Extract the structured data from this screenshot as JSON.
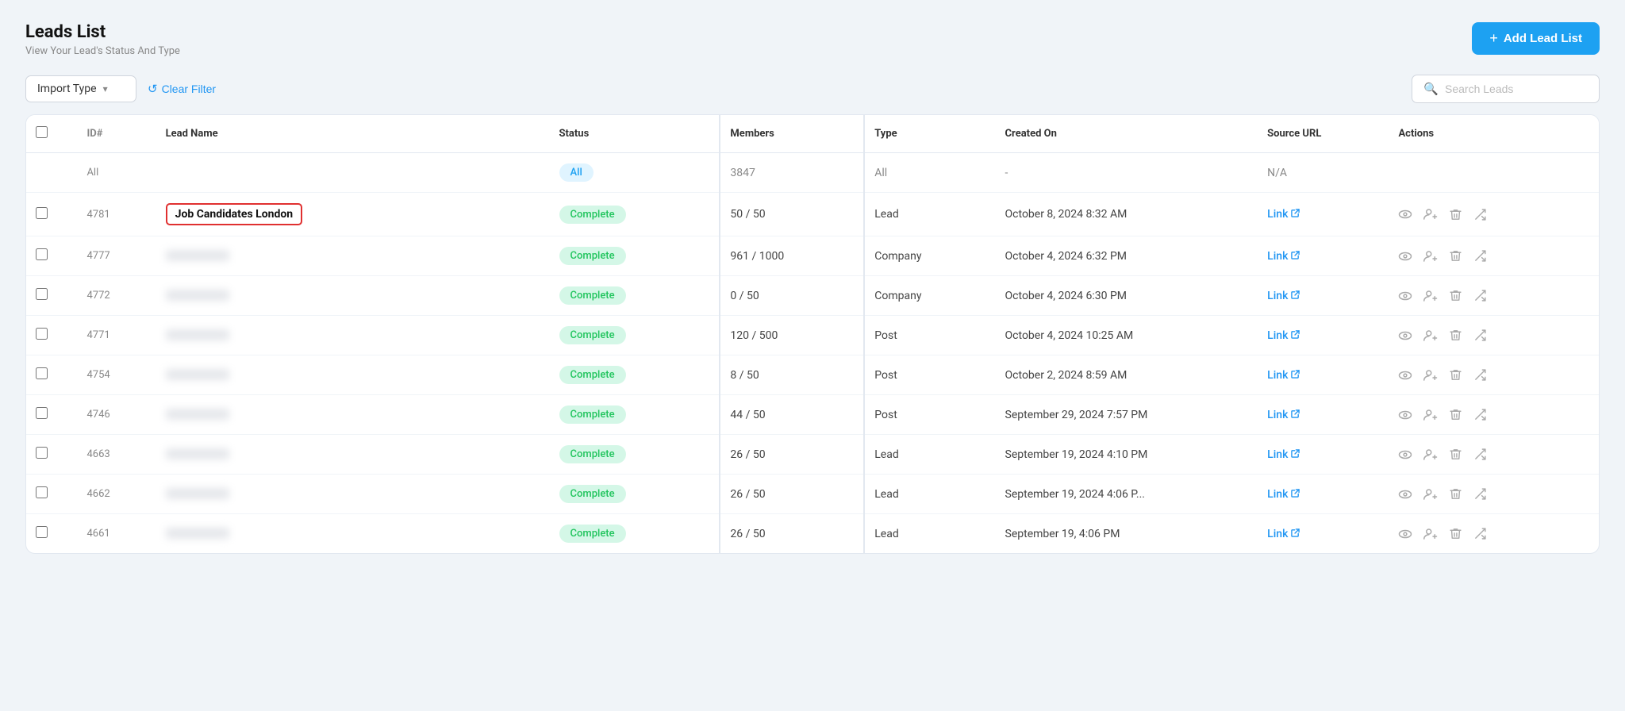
{
  "header": {
    "title": "Leads List",
    "subtitle": "View Your Lead's Status And Type",
    "add_button_label": "Add Lead List"
  },
  "toolbar": {
    "import_type_label": "Import Type",
    "clear_filter_label": "Clear Filter",
    "search_placeholder": "Search Leads"
  },
  "table": {
    "columns": [
      "ID#",
      "Lead Name",
      "Status",
      "Members",
      "Type",
      "Created On",
      "Source URL",
      "Actions"
    ],
    "rows": [
      {
        "id": "All",
        "name": "",
        "blurred": false,
        "is_all": true,
        "status": "All",
        "status_type": "all",
        "members": "3847",
        "type": "All",
        "created": "-",
        "source": "N/A",
        "highlighted": false
      },
      {
        "id": "4781",
        "name": "Job Candidates London",
        "blurred": false,
        "is_all": false,
        "status": "Complete",
        "status_type": "complete",
        "members": "50 / 50",
        "type": "Lead",
        "created": "October 8, 2024 8:32 AM",
        "source": "Link",
        "highlighted": true
      },
      {
        "id": "4777",
        "name": "",
        "blurred": true,
        "is_all": false,
        "status": "Complete",
        "status_type": "complete",
        "members": "961 / 1000",
        "type": "Company",
        "created": "October 4, 2024 6:32 PM",
        "source": "Link",
        "highlighted": false
      },
      {
        "id": "4772",
        "name": "",
        "blurred": true,
        "is_all": false,
        "status": "Complete",
        "status_type": "complete",
        "members": "0 / 50",
        "type": "Company",
        "created": "October 4, 2024 6:30 PM",
        "source": "Link",
        "highlighted": false
      },
      {
        "id": "4771",
        "name": "",
        "blurred": true,
        "is_all": false,
        "status": "Complete",
        "status_type": "complete",
        "members": "120 / 500",
        "type": "Post",
        "created": "October 4, 2024 10:25 AM",
        "source": "Link",
        "highlighted": false
      },
      {
        "id": "4754",
        "name": "",
        "blurred": true,
        "is_all": false,
        "status": "Complete",
        "status_type": "complete",
        "members": "8 / 50",
        "type": "Post",
        "created": "October 2, 2024 8:59 AM",
        "source": "Link",
        "highlighted": false
      },
      {
        "id": "4746",
        "name": "",
        "blurred": true,
        "is_all": false,
        "status": "Complete",
        "status_type": "complete",
        "members": "44 / 50",
        "type": "Post",
        "created": "September 29, 2024 7:57 PM",
        "source": "Link",
        "highlighted": false
      },
      {
        "id": "4663",
        "name": "",
        "blurred": true,
        "is_all": false,
        "status": "Complete",
        "status_type": "complete",
        "members": "26 / 50",
        "type": "Lead",
        "created": "September 19, 2024 4:10 PM",
        "source": "Link",
        "highlighted": false
      },
      {
        "id": "4662",
        "name": "",
        "blurred": true,
        "is_all": false,
        "status": "Complete",
        "status_type": "complete",
        "members": "26 / 50",
        "type": "Lead",
        "created": "September 19, 2024 4:06 P...",
        "source": "Link",
        "highlighted": false
      },
      {
        "id": "4661",
        "name": "",
        "blurred": true,
        "is_all": false,
        "status": "Complete",
        "status_type": "complete",
        "members": "26 / 50",
        "type": "Lead",
        "created": "September 19, 4:06 PM",
        "source": "Link",
        "highlighted": false
      }
    ]
  },
  "icons": {
    "eye": "👁",
    "user_plus": "👤+",
    "delete": "🗑",
    "shuffle": "⇌",
    "external_link": "↗",
    "search": "🔍",
    "refresh": "↺",
    "chevron_down": "▾",
    "plus": "+"
  }
}
